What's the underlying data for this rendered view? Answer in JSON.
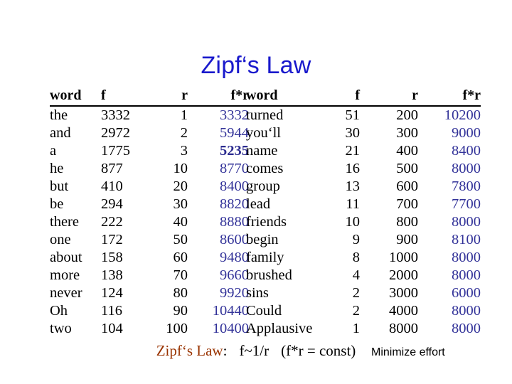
{
  "slide": {
    "title": "Zipf‘s Law",
    "title_color": "#1919cc",
    "background_color": "#ffffff"
  },
  "tables": {
    "headers": [
      "word",
      "f",
      "r",
      "f*r"
    ],
    "fr_color": "#333399",
    "left": {
      "rows": [
        {
          "word": "the",
          "f": "3332",
          "r": "1",
          "fr": "3332",
          "emph": false
        },
        {
          "word": "and",
          "f": "2972",
          "r": "2",
          "fr": "5944",
          "emph": false
        },
        {
          "word": "a",
          "f": "1775",
          "r": "3",
          "fr": "5235",
          "emph": true
        },
        {
          "word": "he",
          "f": "877",
          "r": "10",
          "fr": "8770",
          "emph": false
        },
        {
          "word": "but",
          "f": "410",
          "r": "20",
          "fr": "8400",
          "emph": false
        },
        {
          "word": "be",
          "f": "294",
          "r": "30",
          "fr": "8820",
          "emph": false
        },
        {
          "word": "there",
          "f": "222",
          "r": "40",
          "fr": "8880",
          "emph": false
        },
        {
          "word": "one",
          "f": "172",
          "r": "50",
          "fr": "8600",
          "emph": false
        },
        {
          "word": "about",
          "f": "158",
          "r": "60",
          "fr": "9480",
          "emph": false
        },
        {
          "word": "more",
          "f": "138",
          "r": "70",
          "fr": "9660",
          "emph": false
        },
        {
          "word": "never",
          "f": "124",
          "r": "80",
          "fr": "9920",
          "emph": false
        },
        {
          "word": "Oh",
          "f": "116",
          "r": "90",
          "fr": "10440",
          "emph": false
        },
        {
          "word": "two",
          "f": "104",
          "r": "100",
          "fr": "10400",
          "emph": false
        }
      ]
    },
    "right": {
      "rows": [
        {
          "word": "turned",
          "f": "51",
          "r": "200",
          "fr": "10200",
          "emph": false
        },
        {
          "word": "you‘ll",
          "f": "30",
          "r": "300",
          "fr": "9000",
          "emph": false
        },
        {
          "word": "name",
          "f": "21",
          "r": "400",
          "fr": "8400",
          "emph": false
        },
        {
          "word": "comes",
          "f": "16",
          "r": "500",
          "fr": "8000",
          "emph": false
        },
        {
          "word": "group",
          "f": "13",
          "r": "600",
          "fr": "7800",
          "emph": false
        },
        {
          "word": "lead",
          "f": "11",
          "r": "700",
          "fr": "7700",
          "emph": false
        },
        {
          "word": "friends",
          "f": "10",
          "r": "800",
          "fr": "8000",
          "emph": false
        },
        {
          "word": "begin",
          "f": "9",
          "r": "900",
          "fr": "8100",
          "emph": false
        },
        {
          "word": "family",
          "f": "8",
          "r": "1000",
          "fr": "8000",
          "emph": false
        },
        {
          "word": "brushed",
          "f": "4",
          "r": "2000",
          "fr": "8000",
          "emph": false
        },
        {
          "word": "sins",
          "f": "2",
          "r": "3000",
          "fr": "6000",
          "emph": false
        },
        {
          "word": "Could",
          "f": "2",
          "r": "4000",
          "fr": "8000",
          "emph": false
        },
        {
          "word": "Applausive",
          "f": "1",
          "r": "8000",
          "fr": "8000",
          "emph": false
        }
      ]
    }
  },
  "footer": {
    "law_name": "Zipf‘s Law",
    "law_name_color": "#993300",
    "colon": ":",
    "relation": "f~1/r",
    "constant_note": "(f*r = const)"
  },
  "note": {
    "text": "Minimize effort"
  },
  "chart_data": {
    "type": "table",
    "title": "Zipf‘s Law",
    "columns": [
      "word",
      "f",
      "r",
      "f*r"
    ],
    "annotation": "Zipf‘s Law:  f~1/r  (f*r = const)",
    "rows": [
      [
        "the",
        3332,
        1,
        3332
      ],
      [
        "and",
        2972,
        2,
        5944
      ],
      [
        "a",
        1775,
        3,
        5235
      ],
      [
        "he",
        877,
        10,
        8770
      ],
      [
        "but",
        410,
        20,
        8400
      ],
      [
        "be",
        294,
        30,
        8820
      ],
      [
        "there",
        222,
        40,
        8880
      ],
      [
        "one",
        172,
        50,
        8600
      ],
      [
        "about",
        158,
        60,
        9480
      ],
      [
        "more",
        138,
        70,
        9660
      ],
      [
        "never",
        124,
        80,
        9920
      ],
      [
        "Oh",
        116,
        90,
        10440
      ],
      [
        "two",
        104,
        100,
        10400
      ],
      [
        "turned",
        51,
        200,
        10200
      ],
      [
        "you‘ll",
        30,
        300,
        9000
      ],
      [
        "name",
        21,
        400,
        8400
      ],
      [
        "comes",
        16,
        500,
        8000
      ],
      [
        "group",
        13,
        600,
        7800
      ],
      [
        "lead",
        11,
        700,
        7700
      ],
      [
        "friends",
        10,
        800,
        8000
      ],
      [
        "begin",
        9,
        900,
        8100
      ],
      [
        "family",
        8,
        1000,
        8000
      ],
      [
        "brushed",
        4,
        2000,
        8000
      ],
      [
        "sins",
        2,
        3000,
        6000
      ],
      [
        "Could",
        2,
        4000,
        8000
      ],
      [
        "Applausive",
        1,
        8000,
        8000
      ]
    ]
  }
}
